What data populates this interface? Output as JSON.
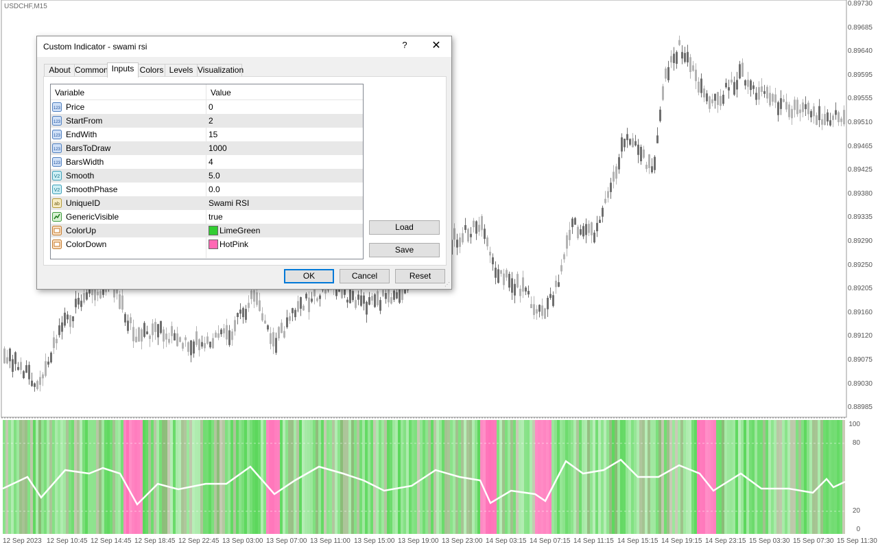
{
  "chart": {
    "symbol": "USDCHF,M15",
    "price_levels": [
      "0.89730",
      "0.89685",
      "0.89640",
      "0.89595",
      "0.89555",
      "0.89510",
      "0.89465",
      "0.89425",
      "0.89380",
      "0.89335",
      "0.89290",
      "0.89250",
      "0.89205",
      "0.89160",
      "0.89120",
      "0.89075",
      "0.89030",
      "0.88985"
    ],
    "indicator_levels": [
      "100",
      "80",
      "20",
      "0"
    ],
    "time_labels": [
      "12 Sep 2023",
      "12 Sep 10:45",
      "12 Sep 14:45",
      "12 Sep 18:45",
      "12 Sep 22:45",
      "13 Sep 03:00",
      "13 Sep 07:00",
      "13 Sep 11:00",
      "13 Sep 15:00",
      "13 Sep 19:00",
      "13 Sep 23:00",
      "14 Sep 03:15",
      "14 Sep 07:15",
      "14 Sep 11:15",
      "14 Sep 15:15",
      "14 Sep 19:15",
      "14 Sep 23:15",
      "15 Sep 03:30",
      "15 Sep 07:30",
      "15 Sep 11:30"
    ],
    "colors": {
      "up": "#32cd32",
      "down": "#ff69b4",
      "candle_bull": "#b3b3b3",
      "candle_bear": "#6e6e6e"
    }
  },
  "dialog": {
    "title": "Custom Indicator - swami rsi",
    "help_label": "?",
    "close_label": "✕",
    "tabs": [
      {
        "label": "About"
      },
      {
        "label": "Common"
      },
      {
        "label": "Inputs"
      },
      {
        "label": "Colors"
      },
      {
        "label": "Levels"
      },
      {
        "label": "Visualization"
      }
    ],
    "active_tab": "Inputs",
    "columns": {
      "variable": "Variable",
      "value": "Value"
    },
    "inputs": [
      {
        "name": "Price",
        "value": "0",
        "icon": "integer-icon"
      },
      {
        "name": "StartFrom",
        "value": "2",
        "icon": "integer-icon"
      },
      {
        "name": "EndWith",
        "value": "15",
        "icon": "integer-icon"
      },
      {
        "name": "BarsToDraw",
        "value": "1000",
        "icon": "integer-icon"
      },
      {
        "name": "BarsWidth",
        "value": "4",
        "icon": "integer-icon"
      },
      {
        "name": "Smooth",
        "value": "5.0",
        "icon": "double-icon"
      },
      {
        "name": "SmoothPhase",
        "value": "0.0",
        "icon": "double-icon"
      },
      {
        "name": "UniqueID",
        "value": "Swami RSI",
        "icon": "string-icon"
      },
      {
        "name": "GenericVisible",
        "value": "true",
        "icon": "bool-icon"
      },
      {
        "name": "ColorUp",
        "value": "LimeGreen",
        "icon": "color-icon",
        "color": "#32cd32"
      },
      {
        "name": "ColorDown",
        "value": "HotPink",
        "icon": "color-icon",
        "color": "#ff69b4"
      }
    ],
    "load_label": "Load",
    "save_label": "Save",
    "ok_label": "OK",
    "cancel_label": "Cancel",
    "reset_label": "Reset"
  }
}
